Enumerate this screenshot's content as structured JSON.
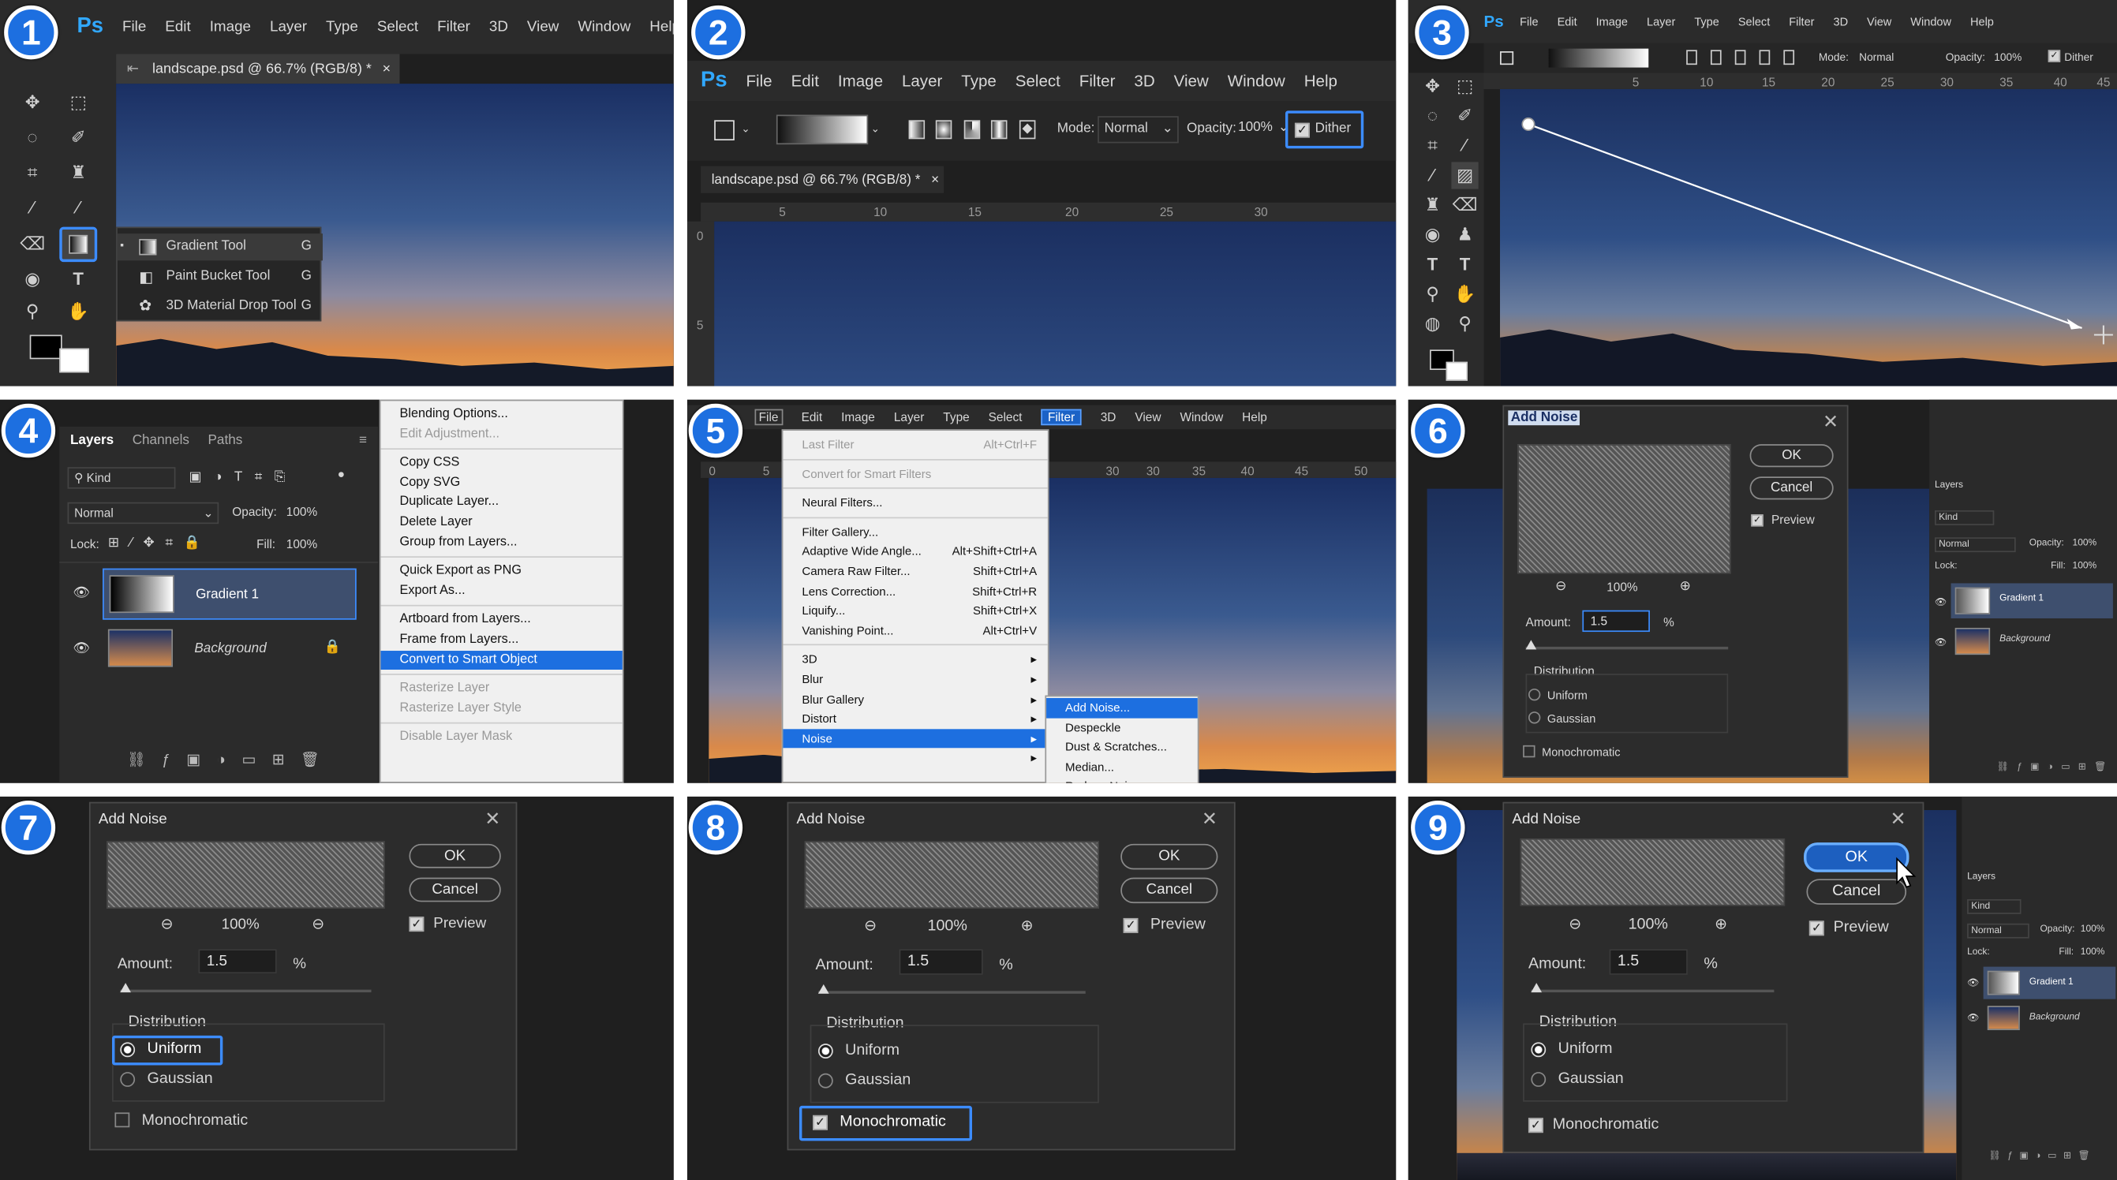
{
  "colors": {
    "accent": "#1d6fe0",
    "highlight": "#3c8cff",
    "ps": "#31a8ff"
  },
  "badges": [
    "1",
    "2",
    "3",
    "4",
    "5",
    "6",
    "7",
    "8",
    "9"
  ],
  "ps_logo": "Ps",
  "menus": {
    "file": "File",
    "edit": "Edit",
    "image": "Image",
    "layer": "Layer",
    "type": "Type",
    "select": "Select",
    "filter": "Filter",
    "three_d": "3D",
    "view": "View",
    "window": "Window",
    "help": "Help"
  },
  "doc_tab": "landscape.psd @ 66.7% (RGB/8) *",
  "tab_close": "×",
  "flyout": [
    {
      "label": "Gradient Tool",
      "key": "G",
      "icon": "gradient-icon"
    },
    {
      "label": "Paint Bucket Tool",
      "key": "G",
      "icon": "paint-bucket-icon"
    },
    {
      "label": "3D Material Drop Tool",
      "key": "G",
      "icon": "material-drop-icon"
    }
  ],
  "options": {
    "mode_label": "Mode:",
    "mode_value": "Normal",
    "opacity_label": "Opacity:",
    "opacity_value": "100%",
    "dither_label": "Dither"
  },
  "ruler_p2": [
    "5",
    "10",
    "15",
    "20",
    "25",
    "30"
  ],
  "ruler_p2_v": [
    "0",
    "5"
  ],
  "ruler_p3": [
    "5",
    "10",
    "15",
    "20",
    "25",
    "30",
    "35",
    "40",
    "45"
  ],
  "ruler_p5": [
    "0",
    "5",
    "30",
    "30",
    "35",
    "40",
    "45",
    "50"
  ],
  "layers_panel": {
    "tabs": [
      "Layers",
      "Channels",
      "Paths"
    ],
    "kind": "Kind",
    "blend": "Normal",
    "opacity_label": "Opacity:",
    "opacity": "100%",
    "lock_label": "Lock:",
    "fill_label": "Fill:",
    "fill": "100%",
    "layers": [
      {
        "name": "Gradient 1"
      },
      {
        "name": "Background"
      }
    ]
  },
  "context_menu": [
    {
      "label": "Blending Options...",
      "state": "normal"
    },
    {
      "label": "Edit Adjustment...",
      "state": "disabled"
    },
    {
      "sep": true
    },
    {
      "label": "Copy CSS",
      "state": "normal"
    },
    {
      "label": "Copy SVG",
      "state": "normal"
    },
    {
      "label": "Duplicate Layer...",
      "state": "normal"
    },
    {
      "label": "Delete Layer",
      "state": "normal"
    },
    {
      "label": "Group from Layers...",
      "state": "normal"
    },
    {
      "sep": true
    },
    {
      "label": "Quick Export as PNG",
      "state": "normal"
    },
    {
      "label": "Export As...",
      "state": "normal"
    },
    {
      "sep": true
    },
    {
      "label": "Artboard from Layers...",
      "state": "normal"
    },
    {
      "label": "Frame from Layers...",
      "state": "normal"
    },
    {
      "label": "Convert to Smart Object",
      "state": "selected"
    },
    {
      "sep": true
    },
    {
      "label": "Rasterize Layer",
      "state": "disabled"
    },
    {
      "label": "Rasterize Layer Style",
      "state": "disabled"
    },
    {
      "sep": true
    },
    {
      "label": "Disable Layer Mask",
      "state": "disabled"
    }
  ],
  "filter_menu": [
    {
      "label": "Last Filter",
      "shortcut": "Alt+Ctrl+F",
      "state": "disabled"
    },
    {
      "sep": true
    },
    {
      "label": "Convert for Smart Filters",
      "shortcut": "",
      "state": "disabled"
    },
    {
      "sep": true
    },
    {
      "label": "Neural Filters...",
      "shortcut": "",
      "state": "normal"
    },
    {
      "sep": true
    },
    {
      "label": "Filter Gallery...",
      "shortcut": "",
      "state": "normal"
    },
    {
      "label": "Adaptive Wide Angle...",
      "shortcut": "Alt+Shift+Ctrl+A",
      "state": "normal"
    },
    {
      "label": "Camera Raw Filter...",
      "shortcut": "Shift+Ctrl+A",
      "state": "normal"
    },
    {
      "label": "Lens Correction...",
      "shortcut": "Shift+Ctrl+R",
      "state": "normal"
    },
    {
      "label": "Liquify...",
      "shortcut": "Shift+Ctrl+X",
      "state": "normal"
    },
    {
      "label": "Vanishing Point...",
      "shortcut": "Alt+Ctrl+V",
      "state": "normal"
    },
    {
      "sep": true
    },
    {
      "label": "3D",
      "shortcut": "▸",
      "state": "normal"
    },
    {
      "label": "Blur",
      "shortcut": "▸",
      "state": "normal"
    },
    {
      "label": "Blur Gallery",
      "shortcut": "▸",
      "state": "normal"
    },
    {
      "label": "Distort",
      "shortcut": "▸",
      "state": "normal"
    },
    {
      "label": "Noise",
      "shortcut": "▸",
      "state": "selected"
    },
    {
      "label": "",
      "shortcut": "▸",
      "state": "normal"
    }
  ],
  "noise_submenu": [
    {
      "label": "Add Noise...",
      "state": "selected"
    },
    {
      "label": "Despeckle",
      "state": "normal"
    },
    {
      "label": "Dust & Scratches...",
      "state": "normal"
    },
    {
      "label": "Median...",
      "state": "normal"
    },
    {
      "label": "Reduce Noise...",
      "state": "normal"
    }
  ],
  "add_noise": {
    "title": "Add Noise",
    "ok": "OK",
    "cancel": "Cancel",
    "preview": "Preview",
    "zoom": "100%",
    "amount_label": "Amount:",
    "amount": "1.5",
    "percent": "%",
    "distribution": "Distribution",
    "uniform": "Uniform",
    "gaussian": "Gaussian",
    "monochromatic": "Monochromatic",
    "close": "✕"
  },
  "mini_layers": {
    "title": "Layers",
    "kind": "Kind",
    "blend": "Normal",
    "opacity_label": "Opacity:",
    "opacity": "100%",
    "lock": "Lock:",
    "fill_label": "Fill:",
    "fill": "100%",
    "layers": [
      "Gradient 1",
      "Background"
    ]
  }
}
